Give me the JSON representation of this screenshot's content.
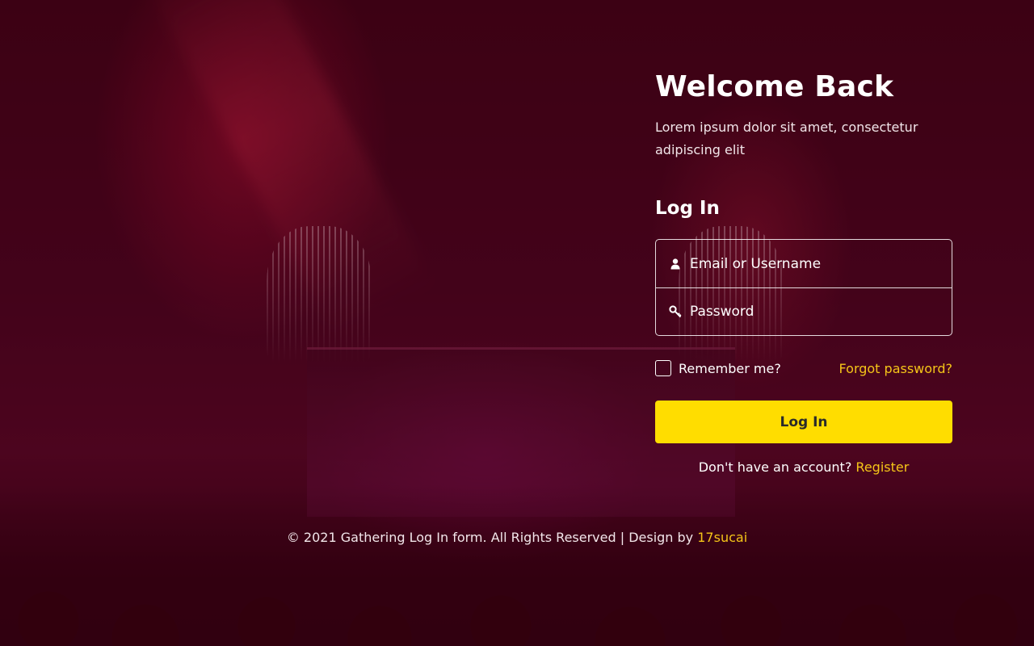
{
  "panel": {
    "welcome_title": "Welcome Back",
    "subtitle": "Lorem ipsum dolor sit amet, consectetur adipiscing elit",
    "login_heading": "Log In"
  },
  "form": {
    "username_placeholder": "Email or Username",
    "username_icon": "user-icon",
    "username_value": "",
    "password_placeholder": "Password",
    "password_icon": "key-icon",
    "password_value": "",
    "remember_label": "Remember me?",
    "remember_checked": false,
    "forgot_label": "Forgot password?",
    "submit_label": "Log In"
  },
  "register": {
    "prompt": "Don't have an account?",
    "link_label": "Register"
  },
  "footer": {
    "text": "© 2021 Gathering Log In form. All Rights Reserved | Design by",
    "link_label": "17sucai"
  },
  "colors": {
    "accent": "#ffdd00",
    "link": "#f5c518",
    "text": "#ffffff",
    "overlay": "#3d0314"
  }
}
